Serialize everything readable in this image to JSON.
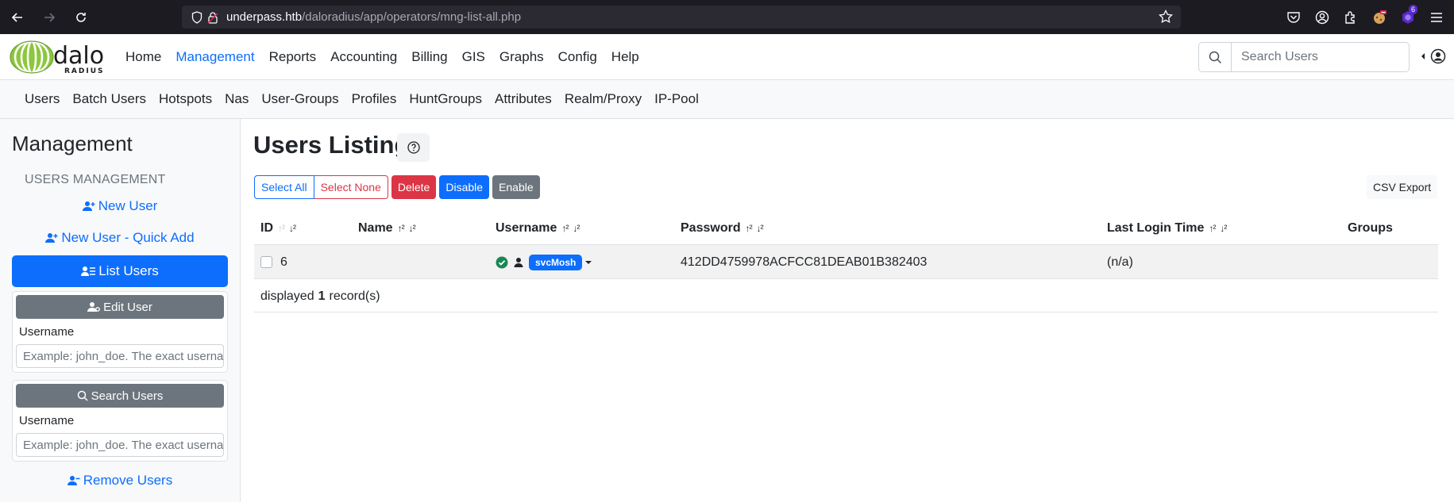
{
  "browser": {
    "url_host": "underpass.htb",
    "url_path": "/daloradius/app/operators/mng-list-all.php",
    "extensions_badge": "6"
  },
  "topnav": {
    "logo_text": "dalo",
    "logo_sub": "RADIUS",
    "links": [
      "Home",
      "Management",
      "Reports",
      "Accounting",
      "Billing",
      "GIS",
      "Graphs",
      "Config",
      "Help"
    ],
    "active": "Management",
    "search_placeholder": "Search Users"
  },
  "subnav": {
    "links": [
      "Users",
      "Batch Users",
      "Hotspots",
      "Nas",
      "User-Groups",
      "Profiles",
      "HuntGroups",
      "Attributes",
      "Realm/Proxy",
      "IP-Pool"
    ]
  },
  "sidebar": {
    "title": "Management",
    "section": "USERS MANAGEMENT",
    "new_user": "New User",
    "new_user_quick": "New User - Quick Add",
    "list_users": "List Users",
    "edit_user": {
      "button": "Edit User",
      "label": "Username",
      "placeholder": "Example: john_doe. The exact username"
    },
    "search_users": {
      "button": "Search Users",
      "label": "Username",
      "placeholder": "Example: john_doe. The exact username"
    },
    "remove_users": "Remove Users"
  },
  "main": {
    "title": "Users Listing",
    "buttons": {
      "select_all": "Select All",
      "select_none": "Select None",
      "delete": "Delete",
      "disable": "Disable",
      "enable": "Enable",
      "csv_export": "CSV Export"
    },
    "table": {
      "headers": [
        "ID",
        "Name",
        "Username",
        "Password",
        "Last Login Time",
        "Groups"
      ],
      "rows": [
        {
          "id": "6",
          "name": "",
          "username": "svcMosh",
          "password": "412DD4759978ACFCC81DEAB01B382403",
          "last_login": "(n/a)",
          "groups": ""
        }
      ],
      "footer_prefix": "displayed",
      "footer_count": "1",
      "footer_suffix": "record(s)"
    }
  },
  "colors": {
    "primary": "#0d6efd",
    "danger": "#dc3545",
    "secondary": "#6c757d",
    "success": "#198754",
    "logo_green": "#8dc63f"
  }
}
